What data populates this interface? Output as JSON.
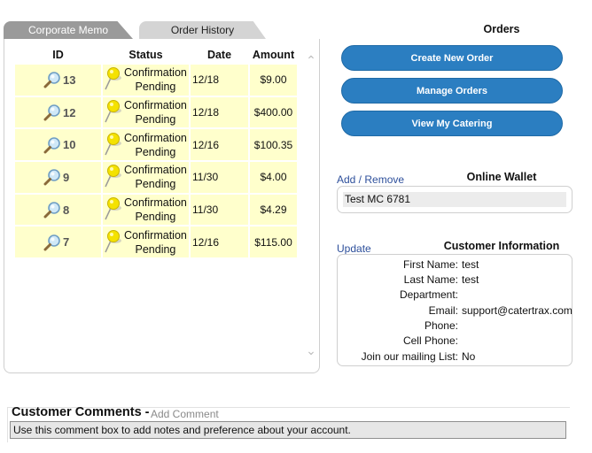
{
  "tabs": [
    {
      "label": "Corporate Memo"
    },
    {
      "label": "Order History"
    }
  ],
  "history": {
    "columns": [
      "ID",
      "Status",
      "Date",
      "Amount"
    ],
    "rows": [
      {
        "id": "13",
        "status_line1": "Confirmation",
        "status_line2": "Pending",
        "date": "12/18",
        "amount": "$9.00"
      },
      {
        "id": "12",
        "status_line1": "Confirmation",
        "status_line2": "Pending",
        "date": "12/18",
        "amount": "$400.00"
      },
      {
        "id": "10",
        "status_line1": "Confirmation",
        "status_line2": "Pending",
        "date": "12/16",
        "amount": "$100.35"
      },
      {
        "id": "9",
        "status_line1": "Confirmation",
        "status_line2": "Pending",
        "date": "11/30",
        "amount": "$4.00"
      },
      {
        "id": "8",
        "status_line1": "Confirmation",
        "status_line2": "Pending",
        "date": "11/30",
        "amount": "$4.29"
      },
      {
        "id": "7",
        "status_line1": "Confirmation",
        "status_line2": "Pending",
        "date": "12/16",
        "amount": "$115.00"
      }
    ],
    "icons": {
      "view": "magnifier-icon",
      "status": "pushpin-icon"
    }
  },
  "orders": {
    "title": "Orders",
    "create_label": "Create New Order",
    "manage_label": "Manage Orders",
    "catering_label": "View My Catering"
  },
  "wallet": {
    "link": "Add / Remove",
    "title": "Online Wallet",
    "items": [
      "Test MC 6781"
    ]
  },
  "customer": {
    "link": "Update",
    "title": "Customer Information",
    "fields": [
      {
        "label": "First Name:",
        "value": "test"
      },
      {
        "label": "Last Name:",
        "value": "test"
      },
      {
        "label": "Department:",
        "value": ""
      },
      {
        "label": "Email:",
        "value": "support@catertrax.com"
      },
      {
        "label": "Phone:",
        "value": ""
      },
      {
        "label": "Cell Phone:",
        "value": ""
      },
      {
        "label": "Join our mailing List:",
        "value": "No"
      }
    ]
  },
  "comments": {
    "title": "Customer Comments -",
    "add_link": "Add Comment",
    "text": "Use this comment box to add notes and preference about your account."
  },
  "colors": {
    "accent": "#2b7ec1",
    "row_bg": "#ffffcc",
    "link": "#2d4f9b"
  }
}
